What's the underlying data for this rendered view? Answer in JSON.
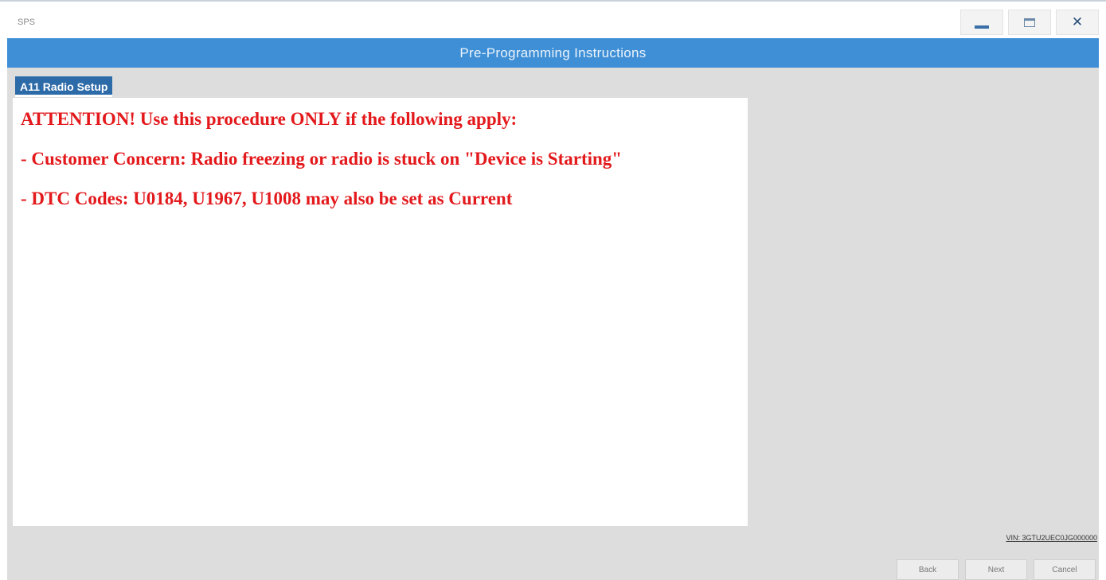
{
  "window": {
    "app_name": "SPS",
    "minimize_icon": "minimize-icon",
    "maximize_icon": "maximize-icon",
    "close_icon": "close-icon"
  },
  "header": {
    "title": "Pre-Programming Instructions"
  },
  "section": {
    "tab_label": "A11 Radio Setup"
  },
  "instructions": {
    "lines": [
      "ATTENTION! Use this procedure ONLY if the following apply:",
      "- Customer Concern: Radio freezing or radio is stuck on \"Device is Starting\"",
      "- DTC Codes: U0184, U1967, U1008 may also be set as Current"
    ],
    "text_color": "#e3191c"
  },
  "footer": {
    "vin": "VIN: 3GTU2UEC0JG000000",
    "back_label": "Back",
    "next_label": "Next",
    "cancel_label": "Cancel"
  },
  "colors": {
    "header_bar": "#3f8fd6",
    "section_tab": "#2d6aa8",
    "content_bg": "#dddddd"
  }
}
